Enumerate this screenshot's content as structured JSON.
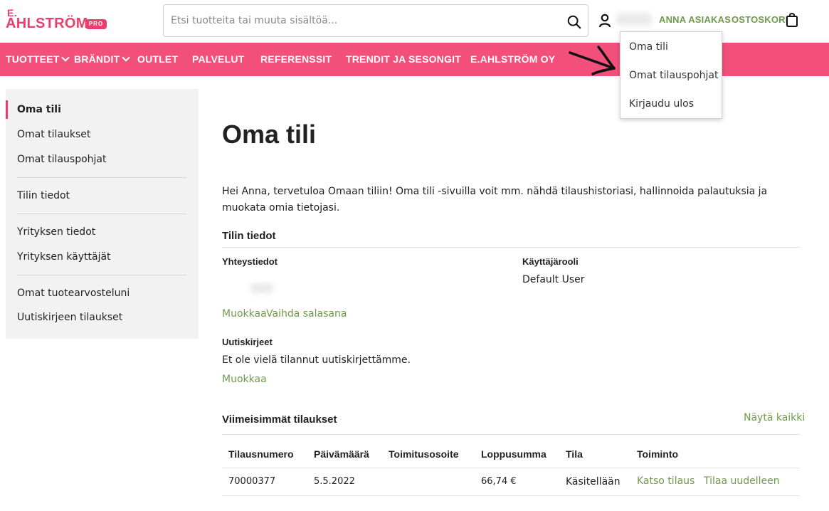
{
  "logo": {
    "line1": "E.",
    "line2": "AHLSTRÖM",
    "badge": "PRO"
  },
  "search": {
    "placeholder": "Etsi tuotteita tai muuta sisältöä..."
  },
  "header": {
    "account_label": "ANNA ASIAKAS",
    "cart_label": "OSTOSKORI"
  },
  "nav": {
    "items": [
      {
        "label": "TUOTTEET",
        "has_dropdown": true
      },
      {
        "label": "BRÄNDIT",
        "has_dropdown": true
      },
      {
        "label": "OUTLET"
      },
      {
        "label": "PALVELUT"
      },
      {
        "label": "REFERENSSIT"
      },
      {
        "label": "TRENDIT JA SESONGIT"
      },
      {
        "label": "E.AHLSTRÖM OY"
      }
    ]
  },
  "account_menu": {
    "items": [
      "Oma tili",
      "Omat tilauspohjat",
      "Kirjaudu ulos"
    ]
  },
  "sidebar": {
    "items": [
      "Oma tili",
      "Omat tilaukset",
      "Omat tilauspohjat",
      "Tilin tiedot",
      "Yrityksen tiedot",
      "Yrityksen käyttäjät",
      "Omat tuotearvosteluni",
      "Uutiskirjeen tilaukset"
    ]
  },
  "page": {
    "title": "Oma tili",
    "welcome": "Hei  Anna,  tervetuloa Omaan tiliin! Oma tili -sivuilla voit mm. nähdä tilaushistoriasi, hallinnoida palautuksia ja muokata omia tietojasi.",
    "account_info": {
      "heading": "Tilin tiedot",
      "contact_heading": "Yhteystiedot",
      "role_heading": "Käyttäjärooli",
      "role_value": "Default User",
      "edit_link": "Muokkaa",
      "change_password_link": "Vaihda salasana"
    },
    "newsletter": {
      "heading": "Uutiskirjeet",
      "text": "Et ole vielä tilannut uutiskirjettämme.",
      "edit_link": "Muokkaa"
    },
    "recent_orders": {
      "heading": "Viimeisimmät tilaukset",
      "show_all": "Näytä kaikki",
      "columns": [
        "Tilausnumero",
        "Päivämäärä",
        "Toimitusosoite",
        "Loppusumma",
        "Tila",
        "Toiminto"
      ],
      "rows": [
        {
          "number": "70000377",
          "date": "5.5.2022",
          "address": "",
          "total": "66,74 €",
          "status": "Käsitellään",
          "view_link": "Katso tilaus",
          "reorder_link": "Tilaa uudelleen"
        }
      ]
    }
  },
  "colors": {
    "brand_pink": "#f2507a",
    "logo_pink": "#e8406d",
    "link_green": "#6f9a4b"
  }
}
